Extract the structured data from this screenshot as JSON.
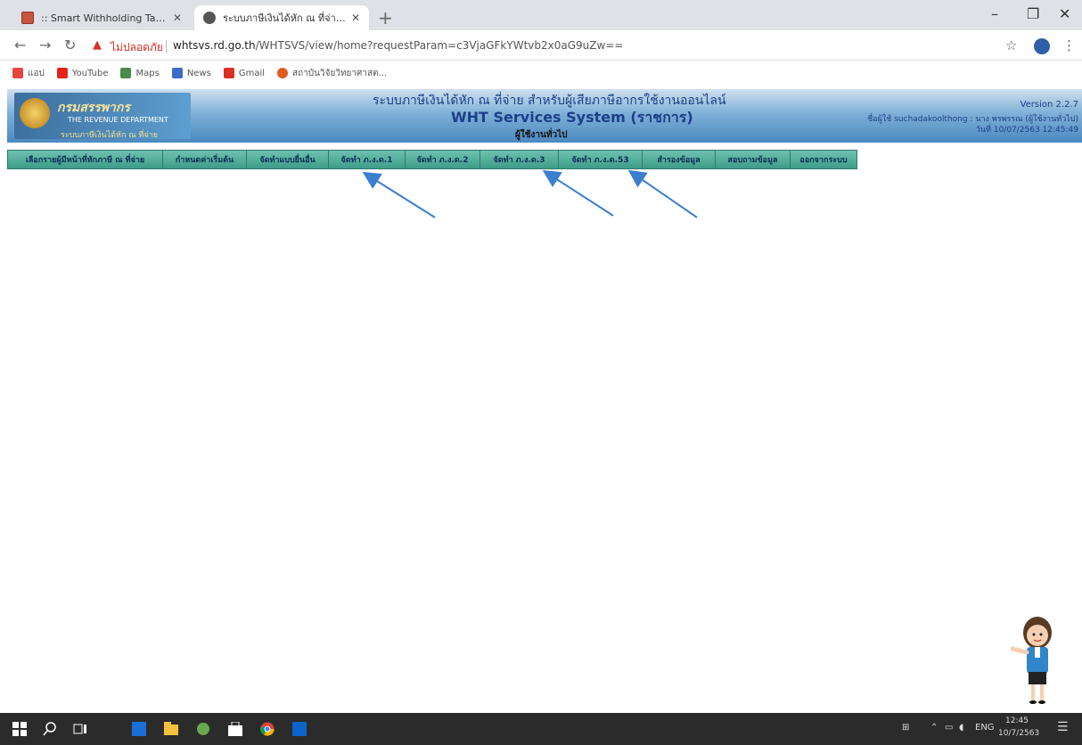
{
  "browser": {
    "tabs": [
      {
        "title": ":: Smart Withholding Tax ::"
      },
      {
        "title": "ระบบภาษีเงินได้หัก ณ ที่จ่าย สำหรับผู้เ"
      }
    ],
    "not_secure_label": "ไม่ปลอดภัย",
    "url_host": "whtsvs.rd.go.th",
    "url_path": "/WHTSVS/view/home?requestParam=c3VjaGFkYWtvb2x0aG9uZw==",
    "bookmarks": [
      {
        "label": "แอป",
        "icon": "apps-grid-icon",
        "color": "#e8453c"
      },
      {
        "label": "YouTube",
        "icon": "youtube-icon",
        "color": "#e62117"
      },
      {
        "label": "Maps",
        "icon": "maps-icon",
        "color": "#4a8a4a"
      },
      {
        "label": "News",
        "icon": "news-icon",
        "color": "#3b6dc8"
      },
      {
        "label": "Gmail",
        "icon": "gmail-icon",
        "color": "#d93025"
      },
      {
        "label": "สถาบันวิจัยวิทยาศาสต...",
        "icon": "institute-icon",
        "color": "#e05a1e"
      }
    ]
  },
  "header": {
    "logo_title": "กรมสรรพากร",
    "logo_subtitle": "THE REVENUE DEPARTMENT",
    "logo_slogan": "ระบบภาษีเงินได้หัก ณ ที่จ่าย",
    "title_thai": "ระบบภาษีเงินได้หัก ณ ที่จ่าย สำหรับผู้เสียภาษีอากรใช้งานออนไลน์",
    "title_en": "WHT Services System  (ราชการ)",
    "user_type": "ผู้ใช้งานทั่วไป",
    "version": "Version 2.2.7",
    "user_line": "ชื่อผู้ใช้  suchadakoolthong : นาง พรพรรณ  (ผู้ใช้งานทั่วไป)",
    "date_line": "วันที่  10/07/2563 12:45:49"
  },
  "menu": [
    "เลือกรายผู้มีหน้าที่หักภาษี ณ ที่จ่าย",
    "กำหนดค่าเริ่มต้น",
    "จัดทำแบบยื่นอื่น",
    "จัดทำ ภ.ง.ด.1",
    "จัดทำ ภ.ง.ด.2",
    "จัดทำ ภ.ง.ด.3",
    "จัดทำ ภ.ง.ด.53",
    "สำรองข้อมูล",
    "สอบถามข้อมูล",
    "ออกจากระบบ"
  ],
  "menu_widths": [],
  "taskbar": {
    "language": "ENG",
    "time": "12:45",
    "date": "10/7/2563"
  }
}
